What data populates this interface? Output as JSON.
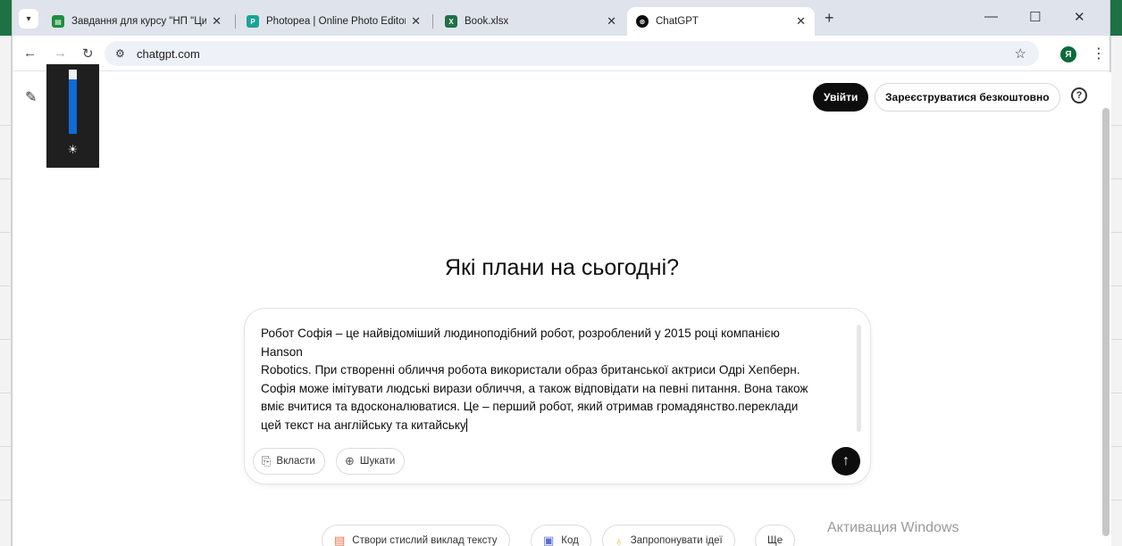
{
  "browser": {
    "tabs": [
      {
        "title": "Завдання для курсу \"НП \"Циф",
        "close": "✕",
        "favicon_color": "#1e8e3e"
      },
      {
        "title": "Photopea | Online Photo Editor",
        "close": "✕",
        "favicon_color": "#18a497"
      },
      {
        "title": "Book.xlsx",
        "close": "✕",
        "favicon_color": "#1e7145"
      },
      {
        "title": "ChatGPT",
        "close": "✕",
        "favicon_color": "#0d0d0d",
        "active": true
      }
    ],
    "new_tab": "+",
    "url": "chatgpt.com",
    "profile_initial": "Я"
  },
  "header": {
    "login_label": "Увійти",
    "signup_label": "Зареєструватися безкоштовно"
  },
  "main": {
    "headline": "Які плани на сьогодні?",
    "prompt_lines": [
      "Робот Софія – це найвідоміший людиноподібний робот, розроблений у 2015 році компанією",
      "Hanson",
      "Robotics. При створенні обличчя робота використали образ британської актриси Одрі Хепберн.",
      "Софія може імітувати людські вирази обличчя, а також відповідати на певні питання. Вона також",
      "вміє вчитися та вдосконалюватися. Це – перший робот, який отримав громадянство.переклади",
      "цей текст на англійську та китайську"
    ],
    "attach_label": "Вкласти",
    "search_label": "Шукати",
    "suggestions": [
      {
        "label": "Створи стислий виклад тексту",
        "icon": "summary-icon",
        "color": "#e8704a"
      },
      {
        "label": "Код",
        "icon": "code-icon",
        "color": "#5b6fd6"
      },
      {
        "label": "Запропонувати ідеї",
        "icon": "lightbulb-icon",
        "color": "#e3b52a"
      },
      {
        "label": "Ще",
        "icon": "",
        "color": "#333333"
      }
    ]
  },
  "overlay": {
    "activation_text": "Активация Windows",
    "brightness_level": 0.85
  }
}
